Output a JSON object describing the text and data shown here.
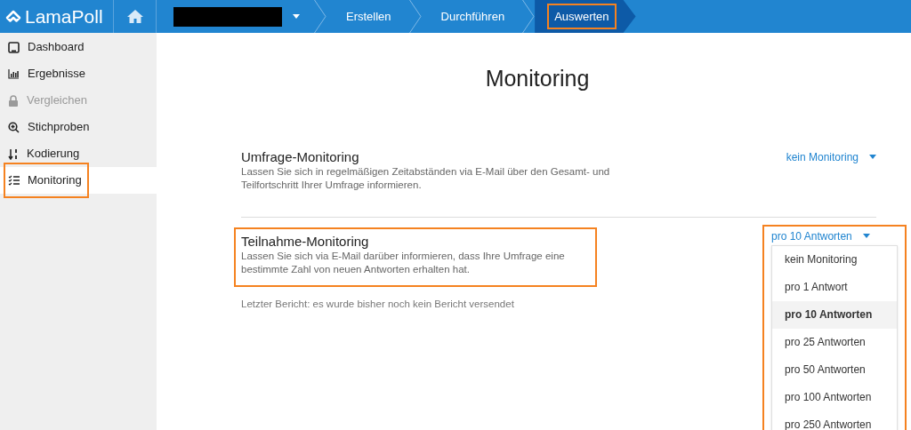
{
  "header": {
    "logo": "LamaPoll",
    "steps": [
      {
        "label": "Erstellen",
        "selected": false,
        "highlighted": false
      },
      {
        "label": "Durchführen",
        "selected": false,
        "highlighted": false
      },
      {
        "label": "Auswerten",
        "selected": true,
        "highlighted": true
      }
    ]
  },
  "sidebar": {
    "items": [
      {
        "label": "Dashboard",
        "selected": false,
        "disabled": false,
        "highlighted": false
      },
      {
        "label": "Ergebnisse",
        "selected": false,
        "disabled": false,
        "highlighted": false
      },
      {
        "label": "Vergleichen",
        "selected": false,
        "disabled": true,
        "highlighted": false
      },
      {
        "label": "Stichproben",
        "selected": false,
        "disabled": false,
        "highlighted": false
      },
      {
        "label": "Kodierung",
        "selected": false,
        "disabled": false,
        "highlighted": false
      },
      {
        "label": "Monitoring",
        "selected": true,
        "disabled": false,
        "highlighted": true
      }
    ]
  },
  "page": {
    "title": "Monitoring",
    "sections": [
      {
        "title": "Umfrage-Monitoring",
        "description": "Lassen Sie sich in regelmäßigen Zeitabständen via E-Mail über den Gesamt- und Teilfortschritt Ihrer Umfrage informieren.",
        "value": "kein Monitoring",
        "highlighted": false
      },
      {
        "title": "Teilnahme-Monitoring",
        "description": "Lassen Sie sich via E-Mail darüber informieren, dass Ihre Umfrage eine bestimmte Zahl von neuen Antworten erhalten hat.",
        "value": "pro 10 Antworten",
        "highlighted": true,
        "expanded": true,
        "note": "Letzter Bericht: es wurde bisher noch kein Bericht versendet",
        "options": [
          {
            "label": "kein Monitoring",
            "selected": false
          },
          {
            "label": "pro 1 Antwort",
            "selected": false
          },
          {
            "label": "pro 10 Antworten",
            "selected": true
          },
          {
            "label": "pro 25 Antworten",
            "selected": false
          },
          {
            "label": "pro 50 Antworten",
            "selected": false
          },
          {
            "label": "pro 100 Antworten",
            "selected": false
          },
          {
            "label": "pro 250 Antworten",
            "selected": false
          }
        ]
      }
    ]
  }
}
